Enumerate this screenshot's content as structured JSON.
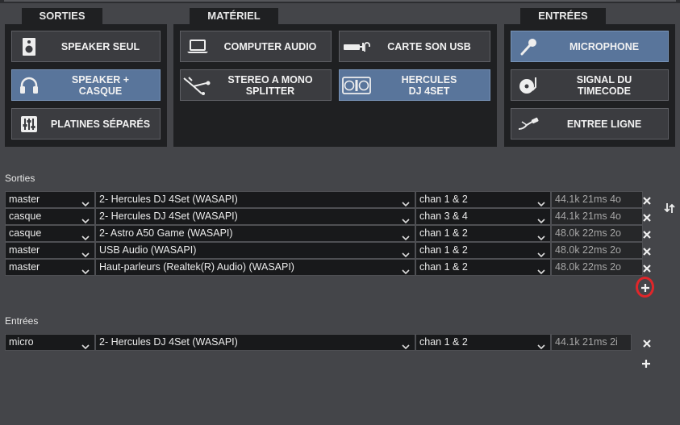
{
  "panels": {
    "sorties": {
      "title": "SORTIES",
      "buttons": [
        {
          "label": "SPEAKER SEUL",
          "icon": "speaker-icon",
          "active": false
        },
        {
          "label": "SPEAKER +\nCASQUE",
          "icon": "headphones-icon",
          "active": true
        },
        {
          "label": "PLATINES SÉPARÉS",
          "icon": "mixer-icon",
          "active": false
        }
      ]
    },
    "materiel": {
      "title": "MATÉRIEL",
      "buttons": [
        {
          "label": "COMPUTER AUDIO",
          "icon": "laptop-icon",
          "active": false
        },
        {
          "label": "CARTE SON USB",
          "icon": "usb-soundcard-icon",
          "active": false
        },
        {
          "label": "STEREO A MONO\nSPLITTER",
          "icon": "splitter-cable-icon",
          "active": false
        },
        {
          "label": "HERCULES\nDJ 4SET",
          "icon": "dj-controller-icon",
          "active": true
        }
      ]
    },
    "entrees": {
      "title": "ENTRÉES",
      "buttons": [
        {
          "label": "MICROPHONE",
          "icon": "microphone-icon",
          "active": true
        },
        {
          "label": "SIGNAL DU\nTIMECODE",
          "icon": "turntable-icon",
          "active": false
        },
        {
          "label": "ENTREE LIGNE",
          "icon": "line-cable-icon",
          "active": false
        }
      ]
    }
  },
  "outputs": {
    "label": "Sorties",
    "rows": [
      {
        "role": "master",
        "device": "2- Hercules DJ 4Set (WASAPI)",
        "channel": "chan 1 & 2",
        "info": "44.1k 21ms 4o"
      },
      {
        "role": "casque",
        "device": "2- Hercules DJ 4Set (WASAPI)",
        "channel": "chan 3 & 4",
        "info": "44.1k 21ms 4o"
      },
      {
        "role": "casque",
        "device": "2- Astro A50 Game (WASAPI)",
        "channel": "chan 1 & 2",
        "info": "48.0k 22ms 2o"
      },
      {
        "role": "master",
        "device": "USB Audio (WASAPI)",
        "channel": "chan 1 & 2",
        "info": "48.0k 22ms 2o"
      },
      {
        "role": "master",
        "device": "Haut-parleurs (Realtek(R) Audio) (WASAPI)",
        "channel": "chan 1 & 2",
        "info": "48.0k 22ms 2o"
      }
    ]
  },
  "inputs": {
    "label": "Entrées",
    "rows": [
      {
        "role": "micro",
        "device": "2- Hercules DJ 4Set (WASAPI)",
        "channel": "chan 1 & 2",
        "info": "44.1k 21ms 2i"
      }
    ]
  },
  "colors": {
    "background": "#444549",
    "panel": "#1f2022",
    "button": "#3b3c40",
    "button_active": "#59759b",
    "highlight_ring": "#e0262a"
  }
}
